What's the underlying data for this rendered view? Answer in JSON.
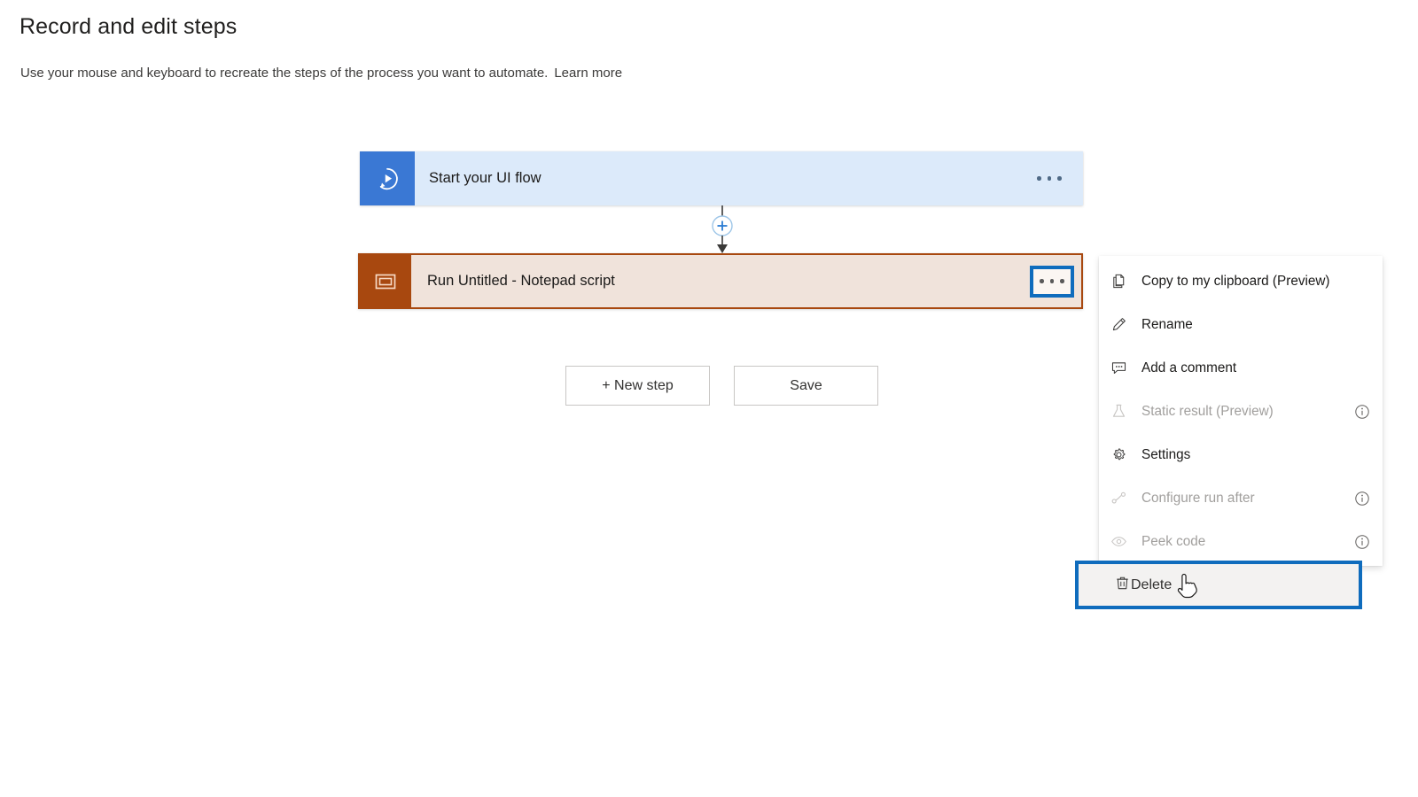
{
  "header": {
    "title": "Record and edit steps",
    "subtitle": "Use your mouse and keyboard to recreate the steps of the process you want to automate.",
    "learn_more": "Learn more"
  },
  "flow": {
    "trigger_card": {
      "label": "Start your UI flow",
      "icon": "ui-flow-play-icon",
      "icon_bg": "#3a78d4",
      "card_bg": "#dceafa",
      "more_button": "trigger-more-button",
      "more_label": "..."
    },
    "connector": {
      "add_label": "+",
      "icon": "add-step-icon"
    },
    "action_card": {
      "label": "Run Untitled - Notepad script",
      "icon": "window-script-icon",
      "icon_bg": "#a8480f",
      "card_bg": "#f0e3db",
      "border_color": "#a8480f",
      "more_button": "action-more-button",
      "more_label": "...",
      "selected": true
    }
  },
  "buttons": {
    "new_step": "+ New step",
    "save": "Save"
  },
  "context_menu": {
    "items": [
      {
        "label": "Copy to my clipboard (Preview)",
        "icon": "copy-icon",
        "disabled": false,
        "info": false
      },
      {
        "label": "Rename",
        "icon": "pencil-icon",
        "disabled": false,
        "info": false
      },
      {
        "label": "Add a comment",
        "icon": "comment-icon",
        "disabled": false,
        "info": false
      },
      {
        "label": "Static result (Preview)",
        "icon": "flask-icon",
        "disabled": true,
        "info": true
      },
      {
        "label": "Settings",
        "icon": "gear-icon",
        "disabled": false,
        "info": false
      },
      {
        "label": "Configure run after",
        "icon": "run-after-icon",
        "disabled": true,
        "info": true
      },
      {
        "label": "Peek code",
        "icon": "eye-icon",
        "disabled": true,
        "info": true
      },
      {
        "label": "Delete",
        "icon": "trash-icon",
        "disabled": false,
        "info": false,
        "highlighted": true
      }
    ]
  },
  "highlight_color": "#0f6cbd"
}
